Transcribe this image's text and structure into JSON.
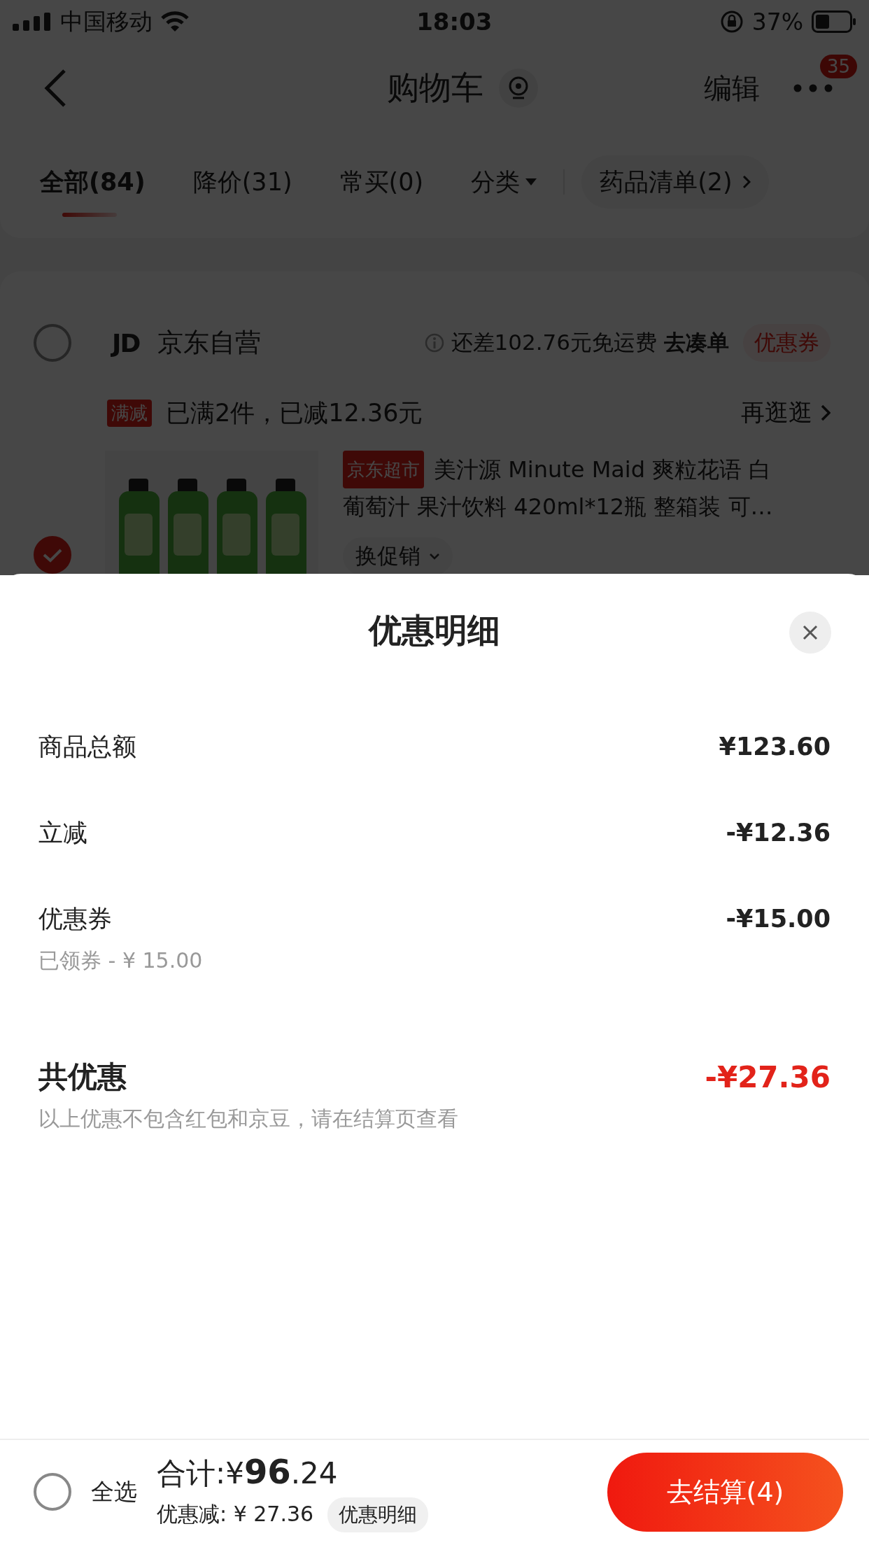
{
  "status_bar": {
    "carrier": "中国移动",
    "time": "18:03",
    "battery": "37%"
  },
  "nav": {
    "title": "购物车",
    "edit": "编辑",
    "badge": "35"
  },
  "tabs": [
    {
      "label": "全部(84)",
      "selected": true,
      "kind": "tab"
    },
    {
      "label": "降价(31)",
      "selected": false,
      "kind": "tab"
    },
    {
      "label": "常买(0)",
      "selected": false,
      "kind": "tab"
    },
    {
      "label": "分类",
      "selected": false,
      "kind": "dropdown"
    }
  ],
  "list_button": "药品清单(2)",
  "store": {
    "logo": "JD",
    "name": "京东自营",
    "checked": false,
    "shipping_note": "还差102.76元免运费",
    "shipping_link": "去凑单",
    "coupon": "优惠券"
  },
  "promo": {
    "tag": "满减",
    "text": "已满2件，已减12.36元",
    "link": "再逛逛"
  },
  "product": {
    "checked": true,
    "tag": "京东超市",
    "title_lines": [
      "美汁源 Minute Maid 爽粒花语 白",
      "葡萄汁 果汁饮料 420ml*12瓶 整箱装 可…"
    ],
    "promo_button": "换促销"
  },
  "sheet": {
    "title": "优惠明细",
    "rows": [
      {
        "kind": "line",
        "label": "商品总额",
        "amount": "¥123.60"
      },
      {
        "kind": "line",
        "label": "立减",
        "amount": "-¥12.36"
      },
      {
        "kind": "line",
        "label": "优惠券",
        "amount": "-¥15.00",
        "note": "已领券 - ¥ 15.00"
      },
      {
        "kind": "total",
        "label": "共优惠",
        "amount": "-¥27.36",
        "note": "以上优惠不包含红包和京豆，请在结算页查看"
      }
    ]
  },
  "footer": {
    "select_all": "全选",
    "checked": false,
    "total": "合计:¥**96**.24",
    "discount": "优惠减: ¥ 27.36",
    "details": "优惠明细",
    "checkout": "去结算(4)"
  }
}
